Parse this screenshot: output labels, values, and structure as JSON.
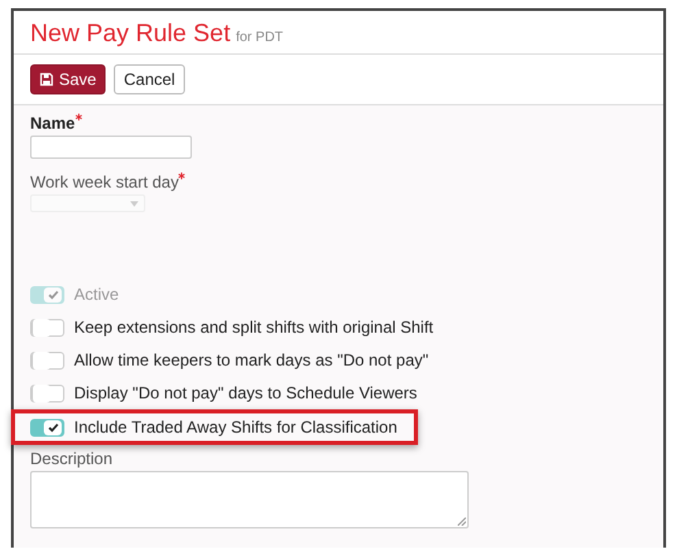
{
  "header": {
    "title": "New Pay Rule Set",
    "subtitle": "for PDT"
  },
  "buttons": [
    {
      "kind": "primary",
      "label": "Save"
    },
    {
      "kind": "default",
      "label": "Cancel"
    }
  ],
  "fields": [
    {
      "kind": "text",
      "label": "Name",
      "required": true,
      "disabled": false
    },
    {
      "kind": "select",
      "label": "Work week start day",
      "required": true,
      "disabled": true
    }
  ],
  "toggles": [
    {
      "label": "Active",
      "checked": true,
      "disabled": true,
      "highlighted": false
    },
    {
      "label": "Keep extensions and split shifts with original Shift",
      "checked": false,
      "disabled": false,
      "highlighted": false
    },
    {
      "label": "Allow time keepers to mark days as \"Do not pay\"",
      "checked": false,
      "disabled": false,
      "highlighted": false
    },
    {
      "label": "Display \"Do not pay\" days to Schedule Viewers",
      "checked": false,
      "disabled": false,
      "highlighted": false
    },
    {
      "label": "Include Traded Away Shifts for Classification",
      "checked": true,
      "disabled": false,
      "highlighted": true
    }
  ],
  "description": {
    "label": "Description"
  }
}
